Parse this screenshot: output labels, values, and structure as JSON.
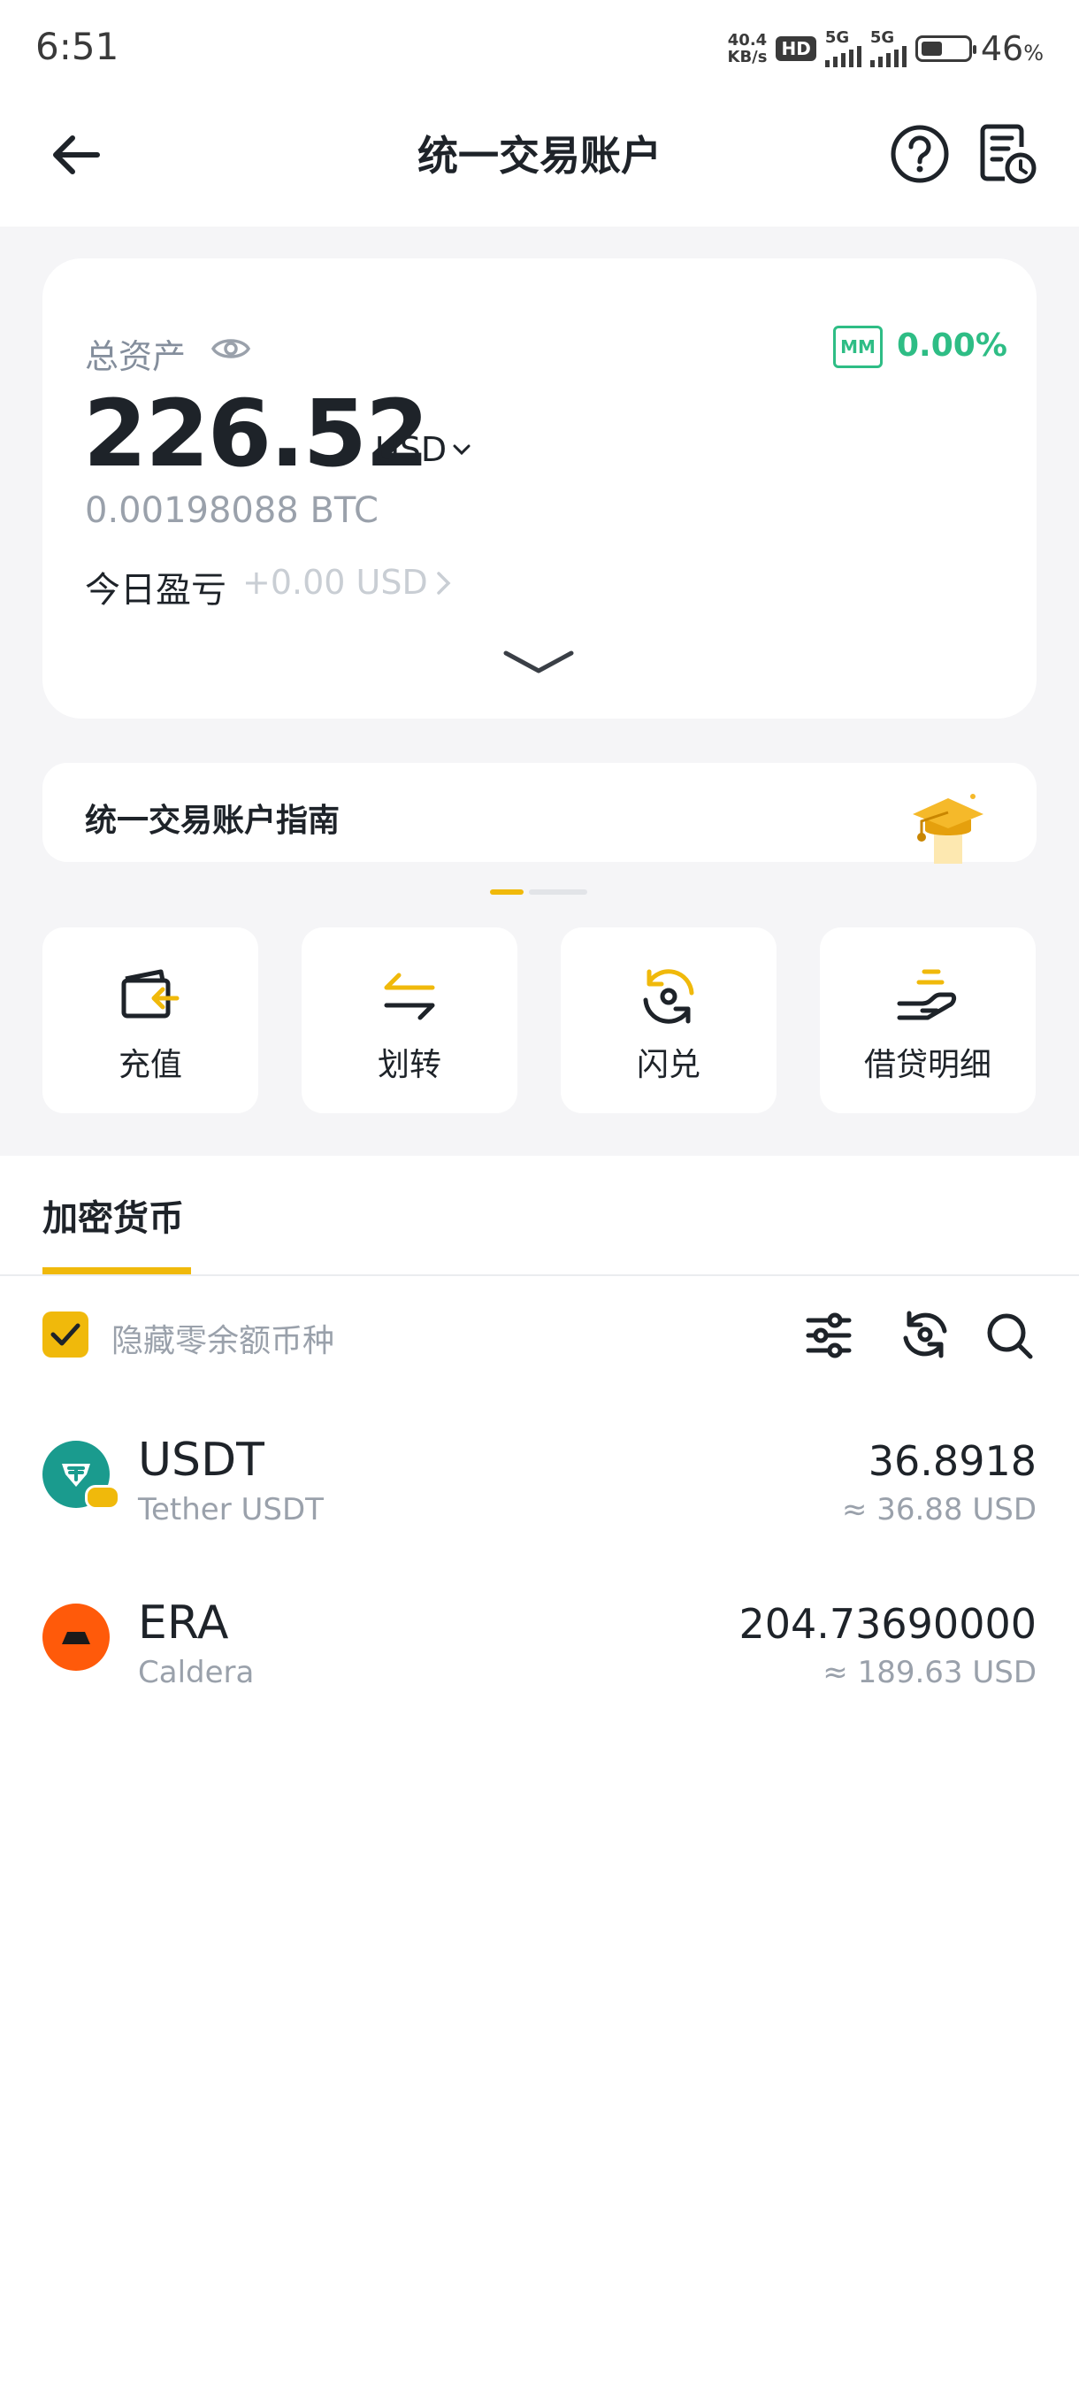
{
  "status_bar": {
    "time": "6:51",
    "net_speed_value": "40.4",
    "net_speed_unit": "KB/s",
    "hd_badge": "HD",
    "sim1_label": "5G",
    "sim2_label": "5G",
    "battery_level": 0.46,
    "battery_value": "46",
    "battery_unit": "%"
  },
  "header": {
    "title": "统一交易账户",
    "back_icon": "arrow-left-icon",
    "help_icon": "question-circle-icon",
    "records_icon": "document-clock-icon"
  },
  "asset_card": {
    "total_label": "总资产",
    "eye_icon": "eye-icon",
    "mm_badge": "MM",
    "margin_ratio": "0.00%",
    "total_value": "226.52",
    "currency": "USD",
    "btc_value": "0.00198088 BTC",
    "pnl_label": "今日盈亏",
    "pnl_value": "+0.00 USD"
  },
  "guide": {
    "title": "统一交易账户指南",
    "illustration_icon": "graduation-cap-icon"
  },
  "actions": [
    {
      "label": "充值",
      "icon": "deposit-wallet-icon"
    },
    {
      "label": "划转",
      "icon": "transfer-arrows-icon"
    },
    {
      "label": "闪兑",
      "icon": "convert-icon"
    },
    {
      "label": "借贷明细",
      "icon": "loan-hand-icon"
    }
  ],
  "crypto": {
    "tab_label": "加密货币",
    "hide_zero_label": "隐藏零余额币种",
    "hide_zero_checked": true
  },
  "assets": [
    {
      "symbol": "USDT",
      "name": "Tether USDT",
      "balance": "36.8918",
      "usd_value": "≈ 36.88 USD",
      "icon_color": "#1a9b8e"
    },
    {
      "symbol": "ERA",
      "name": "Caldera",
      "balance": "204.73690000",
      "usd_value": "≈ 189.63 USD",
      "icon_color": "#ff5a0a"
    }
  ],
  "colors": {
    "accent": "#f0b90b",
    "positive": "#2ebd85",
    "text_primary": "#1e2329",
    "text_secondary": "#9aa1ab",
    "background_gray": "#f5f5f7"
  }
}
